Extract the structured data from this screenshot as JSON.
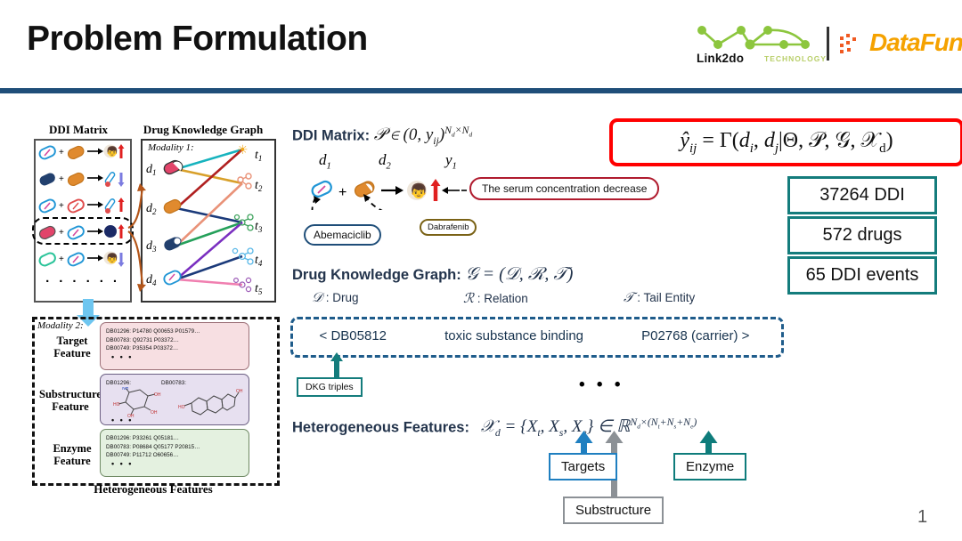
{
  "slide": {
    "title": "Problem Formulation",
    "page_number": "1",
    "accent_rule_color": "#1F4E79"
  },
  "logo": {
    "brand_left": "Link2do",
    "brand_left_sub": "TECHNOLOGY",
    "brand_right": "DataFun.",
    "brand_left_color": "#8CC63E",
    "brand_right_color": "#F5A200"
  },
  "left_panel": {
    "ddi_matrix_heading": "DDI Matrix",
    "dkg_heading": "Drug Knowledge Graph",
    "modality1_label": "Modality 1:",
    "modality2_label": "Modality 2:",
    "ddi_ellipsis": "· · · · · ·",
    "ddi_rows": [
      {
        "drug_a_color": "#2196D6",
        "drug_b_color": "#E08A2E",
        "effect_icon": "person-icon",
        "trend": "up",
        "trend_color": "#E02020"
      },
      {
        "drug_a_color": "#22406E",
        "drug_b_color": "#E08A2E",
        "effect_icon": "thermometer-icon",
        "trend": "down",
        "trend_color": "#7B7BE0"
      },
      {
        "drug_a_color": "#2196D6",
        "drug_b_color": "#E04B4B",
        "effect_icon": "thermometer-icon",
        "trend": "up",
        "trend_color": "#E02020"
      },
      {
        "drug_a_color": "#E2446A",
        "drug_b_color": "#2196D6",
        "effect_icon": "blood-drop-icon",
        "trend": "up",
        "trend_color": "#E02020"
      },
      {
        "drug_a_color": "#2BC49A",
        "drug_b_color": "#2196D6",
        "effect_icon": "person-icon",
        "trend": "down",
        "trend_color": "#7B7BE0"
      }
    ],
    "kg_drug_nodes": [
      "d1",
      "d2",
      "d3",
      "d4"
    ],
    "kg_tail_nodes": [
      "t1",
      "t2",
      "t3",
      "t4",
      "t5"
    ],
    "hetero_caption": "Heterogeneous Features",
    "features": [
      {
        "label_line1": "Target",
        "label_line2": "Feature",
        "box_bg": "#f7dfe2",
        "lines": [
          "DB01296: P14780 Q00653 P01579…",
          "DB00783: Q92731 P03372…",
          "DB00749: P35354 P03372…"
        ],
        "ellipsis": "• • •"
      },
      {
        "label_line1": "Substructure",
        "label_line2": "Feature",
        "box_bg": "#e7e0f0",
        "lines": [
          "DB01296:",
          "DB00783:"
        ],
        "ellipsis": "• • •"
      },
      {
        "label_line1": "Enzyme",
        "label_line2": "Feature",
        "box_bg": "#e4f1e0",
        "lines": [
          "DB01296: P33261 Q05181…",
          "DB00783: P08684 Q05177 P20815…",
          "DB00749: P11712 O60656…"
        ],
        "ellipsis": "• • •"
      }
    ]
  },
  "middle": {
    "ddi_matrix_label": "DDI Matrix:",
    "ddi_matrix_formula": "Y ∈ (0, y_ij)^(Nd × Nd)",
    "d1_label": "d1",
    "d2_label": "d2",
    "y1_label": "y1",
    "serum_callout": "The serum concentration decrease",
    "abemaciclib_callout": "Abemaciclib",
    "dabrafenib_callout": "Dabrafenib",
    "dkg_label": "Drug Knowledge Graph:",
    "dkg_formula": "G = (D, R, T)",
    "drug_part": "Drug",
    "relation_part": "Relation",
    "tail_part": "Tail Entity",
    "triple_head": "< DB05812",
    "triple_relation": "toxic substance binding",
    "triple_tail": "P02768 (carrier) >",
    "dkg_triples_tag": "DKG triples",
    "triple_ellipsis": "• • •",
    "hetero_label": "Heterogeneous Features:",
    "hetero_formula": "Xd = {Xt, Xs, Xe} ∈ R^(Nd×(Nt+Ns+Ne))",
    "targets_tag": "Targets",
    "enzyme_tag": "Enzyme",
    "substructure_tag": "Substructure"
  },
  "right": {
    "model_formula": "ŷij = Γ(di, dj | Θ, Y, G, Xd)",
    "formula_border_color": "#FF0000",
    "stats": [
      "37264 DDI",
      "572 drugs",
      "65 DDI events"
    ],
    "stats_border_color": "#147C7C"
  }
}
